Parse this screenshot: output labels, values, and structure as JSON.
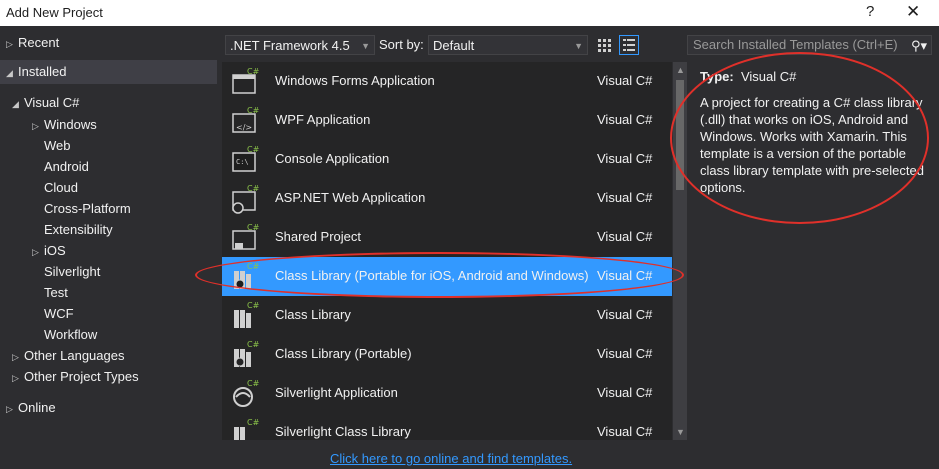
{
  "window": {
    "title": "Add New Project",
    "help_glyph": "?",
    "close_glyph": "✕"
  },
  "tree": {
    "recent": "Recent",
    "installed": "Installed",
    "visual_csharp": "Visual C#",
    "children": [
      "Windows",
      "Web",
      "Android",
      "Cloud",
      "Cross-Platform",
      "Extensibility",
      "iOS",
      "Silverlight",
      "Test",
      "WCF",
      "Workflow"
    ],
    "other_languages": "Other Languages",
    "other_project_types": "Other Project Types",
    "online": "Online"
  },
  "toolbar": {
    "framework": ".NET Framework 4.5",
    "sort_label": "Sort by:",
    "sort_value": "Default",
    "search_placeholder": "Search Installed Templates (Ctrl+E)"
  },
  "templates": [
    {
      "name": "Windows Forms Application",
      "lang": "Visual C#"
    },
    {
      "name": "WPF Application",
      "lang": "Visual C#"
    },
    {
      "name": "Console Application",
      "lang": "Visual C#"
    },
    {
      "name": "ASP.NET Web Application",
      "lang": "Visual C#"
    },
    {
      "name": "Shared Project",
      "lang": "Visual C#"
    },
    {
      "name": "Class Library (Portable for iOS, Android and Windows)",
      "lang": "Visual C#",
      "selected": true
    },
    {
      "name": "Class Library",
      "lang": "Visual C#"
    },
    {
      "name": "Class Library (Portable)",
      "lang": "Visual C#"
    },
    {
      "name": "Silverlight Application",
      "lang": "Visual C#"
    },
    {
      "name": "Silverlight Class Library",
      "lang": "Visual C#"
    }
  ],
  "details": {
    "type_label": "Type:",
    "type_value": "Visual C#",
    "description": "A project for creating a C# class library (.dll) that works on iOS, Android and Windows. Works with Xamarin. This template is a version of the portable class library template with pre-selected options."
  },
  "footer": {
    "online_link": "Click here to go online and find templates."
  },
  "colors": {
    "background": "#2d2d30",
    "list_background": "#252526",
    "selection": "#3399ff",
    "annotation_red": "#e0302a"
  }
}
